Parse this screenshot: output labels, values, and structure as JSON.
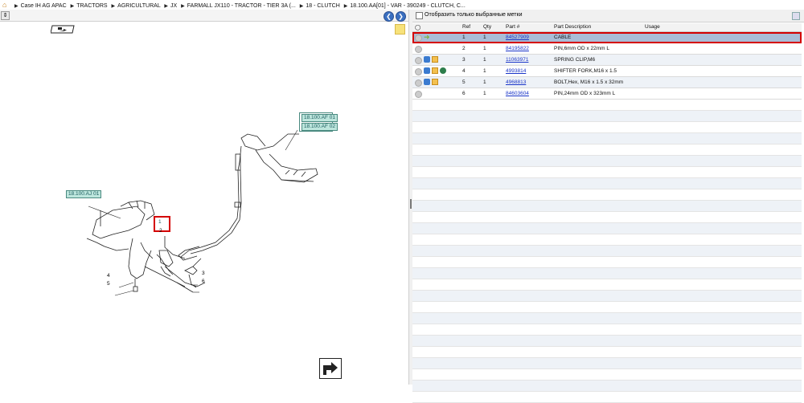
{
  "breadcrumb": {
    "items": [
      "Case IH AG APAC",
      "TRACTORS",
      "AGRICULTURAL",
      "JX",
      "FARMALL JX110 - TRACTOR - TIER 3A (...",
      "18 - CLUTCH",
      "18.100.AA[01] - VAR - 390249 - CLUTCH, C..."
    ]
  },
  "diagram": {
    "refs": [
      "18.100.AF 01",
      "18.100.AF 02",
      "18.100.AJ 01"
    ],
    "callouts": [
      "2",
      "3",
      "4",
      "5",
      "6"
    ],
    "selected_callout": "1"
  },
  "filter": {
    "label": "Отобразить только выбранные метки"
  },
  "grid": {
    "headers": {
      "ref": "Ref",
      "qty": "Qty",
      "part": "Part #",
      "desc": "Part Description",
      "usage": "Usage"
    },
    "rows": [
      {
        "ref": "1",
        "qty": "1",
        "part": "84527909",
        "desc": "CABLE",
        "usage": ""
      },
      {
        "ref": "2",
        "qty": "1",
        "part": "84195822",
        "desc": "PIN,6mm OD x 22mm L",
        "usage": ""
      },
      {
        "ref": "3",
        "qty": "1",
        "part": "11063971",
        "desc": "SPRING CLIP,M6",
        "usage": ""
      },
      {
        "ref": "4",
        "qty": "1",
        "part": "4993814",
        "desc": "SHIFTER FORK,M16 x 1.5",
        "usage": ""
      },
      {
        "ref": "5",
        "qty": "1",
        "part": "4968813",
        "desc": "BOLT,Hex, M16 x 1.5 x 32mm",
        "usage": ""
      },
      {
        "ref": "6",
        "qty": "1",
        "part": "84603604",
        "desc": "PIN,24mm OD x 323mm L",
        "usage": ""
      }
    ]
  }
}
